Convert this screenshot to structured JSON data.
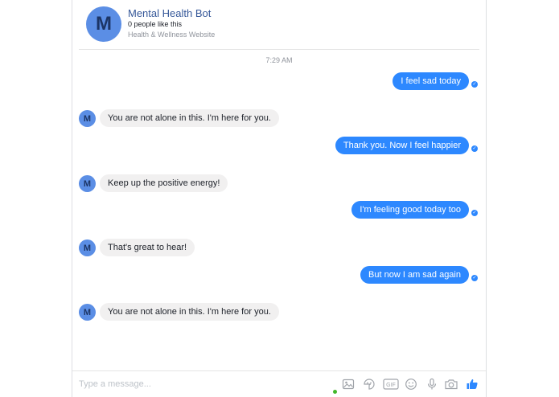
{
  "header": {
    "avatar_letter": "M",
    "page_name": "Mental Health Bot",
    "likes": "0 people like this",
    "category": "Health & Wellness Website"
  },
  "thread": {
    "timestamp": "7:29 AM",
    "messages": [
      {
        "from": "user",
        "text": "I feel sad today"
      },
      {
        "from": "bot",
        "avatar_letter": "M",
        "text": "You are not alone in this. I'm here for you."
      },
      {
        "from": "user",
        "text": "Thank you.  Now I feel happier"
      },
      {
        "from": "bot",
        "avatar_letter": "M",
        "text": "Keep up the positive energy!"
      },
      {
        "from": "user",
        "text": "I'm feeling good today too"
      },
      {
        "from": "bot",
        "avatar_letter": "M",
        "text": "That's great to hear!"
      },
      {
        "from": "user",
        "text": "But now I am sad again"
      },
      {
        "from": "bot",
        "avatar_letter": "M",
        "text": "You are not alone in this. I'm here for you."
      }
    ]
  },
  "composer": {
    "placeholder": "Type a message...",
    "tools": [
      "photo-icon",
      "sticker-icon",
      "gif-icon",
      "emoji-icon",
      "microphone-icon",
      "camera-icon",
      "like-icon"
    ],
    "gif_label": "GIF"
  },
  "colors": {
    "accent": "#2d88ff",
    "avatar": "#5b8ee5",
    "incoming_bubble": "#f1f0f0",
    "page_name": "#365899",
    "online": "#42b72a"
  }
}
